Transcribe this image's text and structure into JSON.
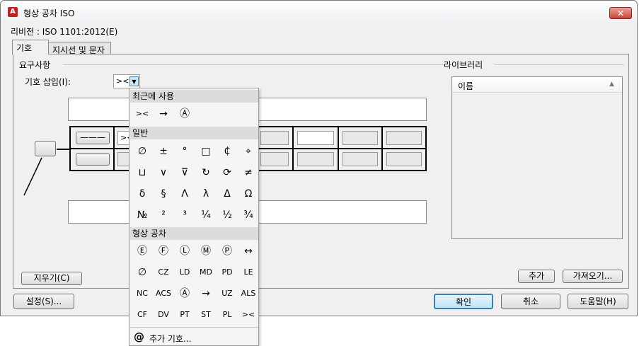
{
  "window": {
    "title": "형상 공차 ISO",
    "close": "✕"
  },
  "revision": "리비전 : ISO 1101:2012(E)",
  "tabs": [
    "기호",
    "지시선 및 문자"
  ],
  "requirements": {
    "section": "요구사항",
    "insert_label": "기호 삽입(I):",
    "insert_value": "><",
    "first_cell": "><"
  },
  "library": {
    "section": "라이브러리",
    "col_name": "이름"
  },
  "buttons": {
    "clear": "지우기(C)",
    "add": "추가",
    "import": "가져오기...",
    "settings": "설정(S)...",
    "ok": "확인",
    "cancel": "취소",
    "help": "도움말(H)"
  },
  "dropdown": {
    "recent_header": "최근에 사용",
    "recent": [
      "><",
      "→",
      "Ⓐ"
    ],
    "general_header": "일반",
    "general": [
      [
        "∅",
        "±",
        "°",
        "□",
        "₵",
        "⌖"
      ],
      [
        "⊔",
        "∨",
        "⊽",
        "↻",
        "⟳",
        "≠"
      ],
      [
        "δ",
        "§",
        "Λ",
        "λ",
        "Δ",
        "Ω"
      ],
      [
        "№",
        "²",
        "³",
        "¼",
        "½",
        "¾"
      ]
    ],
    "gtol_header": "형상 공차",
    "gtol": [
      [
        "Ⓔ",
        "Ⓕ",
        "Ⓛ",
        "Ⓜ",
        "Ⓟ",
        "↔"
      ],
      [
        "∅",
        "CZ",
        "LD",
        "MD",
        "PD",
        "LE"
      ],
      [
        "NC",
        "ACS",
        "Ⓐ",
        "→",
        "UZ",
        "ALS"
      ],
      [
        "CF",
        "DV",
        "PT",
        "ST",
        "PL",
        "><"
      ]
    ],
    "more_icon": "@",
    "more": "추가 기호..."
  }
}
